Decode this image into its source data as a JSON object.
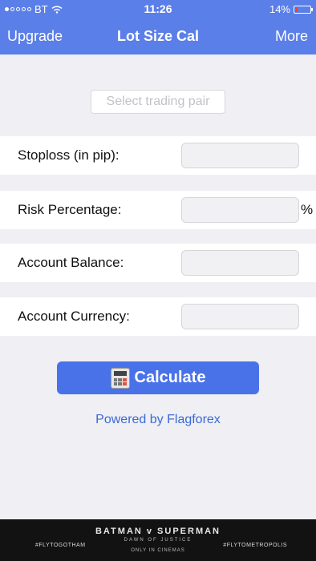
{
  "status_bar": {
    "carrier": "BT",
    "time": "11:26",
    "battery": "14%",
    "battery_level": 0.14
  },
  "nav": {
    "left_label": "Upgrade",
    "title": "Lot Size Cal",
    "right_label": "More"
  },
  "pair_selector": {
    "label": "Select trading pair"
  },
  "form": {
    "stoploss_label": "Stoploss (in pip):",
    "risk_label": "Risk Percentage:",
    "risk_suffix": "%",
    "balance_label": "Account Balance:",
    "currency_label": "Account Currency:"
  },
  "actions": {
    "calculate_label": "Calculate"
  },
  "footer": {
    "powered_by": "Powered by Flagforex"
  },
  "ad": {
    "left_tag": "#FLYTOGOTHAM",
    "title": "BATMAN v SUPERMAN",
    "subtitle": "DAWN OF JUSTICE",
    "bottom": "ONLY IN CINEMAS",
    "right_tag": "#FLYTOMETROPOLIS"
  }
}
